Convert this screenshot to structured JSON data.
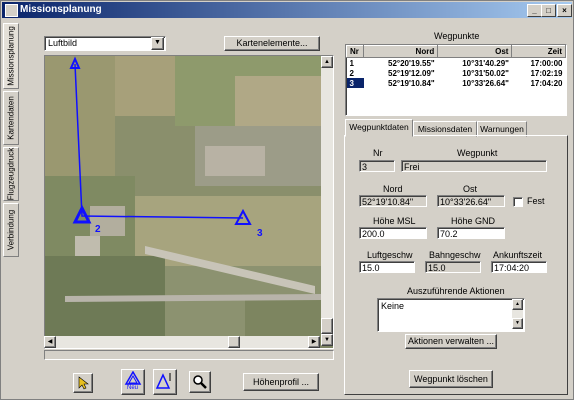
{
  "window": {
    "title": "Missionsplanung"
  },
  "side_tabs": [
    "Missionsplanung",
    "Kartendaten",
    "Flugzeugdruck",
    "Verbindung"
  ],
  "map": {
    "layer_select": "Luftbild",
    "elements_button": "Kartenelemente...",
    "waypoint_markers": [
      "1",
      "2",
      "3"
    ]
  },
  "waypoints": {
    "title": "Wegpunkte",
    "columns": [
      "Nr",
      "Nord",
      "Ost",
      "Zeit"
    ],
    "rows": [
      [
        "1",
        "52°20'19.55\"",
        "10°31'40.29\"",
        "17:00:00"
      ],
      [
        "2",
        "52°19'12.09\"",
        "10°31'50.02\"",
        "17:02:19"
      ],
      [
        "3",
        "52°19'10.84\"",
        "10°33'26.64\"",
        "17:04:20"
      ]
    ],
    "selected_row": 2
  },
  "tabs": [
    "Wegpunktdaten",
    "Missionsdaten",
    "Warnungen"
  ],
  "detail": {
    "nr_label": "Nr",
    "nr_value": "3",
    "wegpunkt_label": "Wegpunkt",
    "wegpunkt_value": "Frei",
    "nord_label": "Nord",
    "nord_value": "52°19'10.84\"",
    "ost_label": "Ost",
    "ost_value": "10°33'26.64\"",
    "fest_label": "Fest",
    "hoehe_msl_label": "Höhe MSL",
    "hoehe_msl_value": "200.0",
    "hoehe_gnd_label": "Höhe GND",
    "hoehe_gnd_value": "70.2",
    "luftgeschw_label": "Luftgeschw",
    "luftgeschw_value": "15.0",
    "bahngeschw_label": "Bahngeschw",
    "bahngeschw_value": "15.0",
    "ankunftszeit_label": "Ankunftszeit",
    "ankunftszeit_value": "17:04:20",
    "aktionen_label": "Auszuführende Aktionen",
    "aktionen_value": "Keine",
    "aktionen_button": "Aktionen verwalten ...",
    "delete_button": "Wegpunkt löschen"
  },
  "toolbar": {
    "neu_label": "Neu",
    "hoehenprofil_button": "Höhenprofil ..."
  }
}
